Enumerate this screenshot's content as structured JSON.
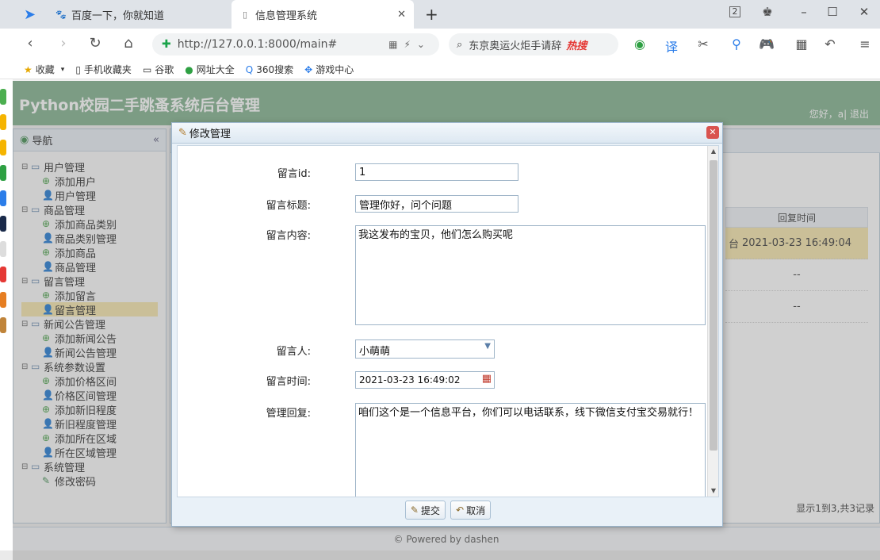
{
  "browser": {
    "tabs": [
      {
        "label": "百度一下，你就知道",
        "icon": "paw-icon"
      },
      {
        "label": "信息管理系统",
        "icon": "document-icon"
      }
    ],
    "tab_count": "2",
    "url": "http://127.0.0.1:8000/main#",
    "search_text": "东京奥运火炬手请辞",
    "search_hot": "热搜",
    "bookmarks": [
      "收藏",
      "手机收藏夹",
      "谷歌",
      "网址大全",
      "360搜索",
      "游戏中心"
    ]
  },
  "app": {
    "title": "Python校园二手跳蚤系统后台管理",
    "user_text": "您好，a| 退出"
  },
  "sidebar": {
    "header": "导航",
    "groups": [
      {
        "label": "用户管理",
        "items": [
          "添加用户",
          "用户管理"
        ]
      },
      {
        "label": "商品管理",
        "items": [
          "添加商品类别",
          "商品类别管理",
          "添加商品",
          "商品管理"
        ]
      },
      {
        "label": "留言管理",
        "items": [
          "添加留言",
          "留言管理"
        ]
      },
      {
        "label": "新闻公告管理",
        "items": [
          "添加新闻公告",
          "新闻公告管理"
        ]
      },
      {
        "label": "系统参数设置",
        "items": [
          "添加价格区间",
          "价格区间管理",
          "添加新旧程度",
          "新旧程度管理",
          "添加所在区域",
          "所在区域管理"
        ]
      },
      {
        "label": "系统管理",
        "items": [
          "修改密码"
        ]
      }
    ]
  },
  "grid": {
    "column": "回复时间",
    "rows": [
      "2021-03-23 16:49:04",
      "--",
      "--"
    ],
    "clip_text": "台",
    "pager": "显示1到3,共3记录"
  },
  "dialog": {
    "title": "修改管理",
    "fields": {
      "id_label": "留言id:",
      "id_value": "1",
      "title_label": "留言标题:",
      "title_value": "管理你好，问个问题",
      "content_label": "留言内容:",
      "content_value": "我这发布的宝贝，他们怎么购买呢",
      "author_label": "留言人:",
      "author_value": "小萌萌",
      "time_label": "留言时间:",
      "time_value": "2021-03-23 16:49:02",
      "reply_label": "管理回复:",
      "reply_value": "咱们这个是一个信息平台，你们可以电话联系，线下微信支付宝交易就行！"
    },
    "submit": "提交",
    "cancel": "取消"
  },
  "footer": "© Powered by dashen"
}
